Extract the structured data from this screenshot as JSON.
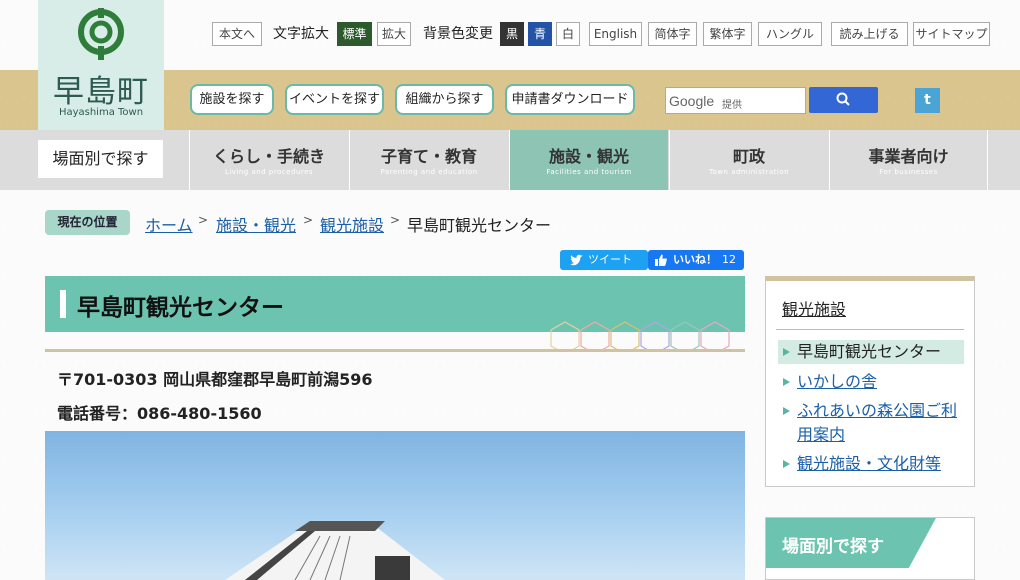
{
  "logo": {
    "name": "早島町",
    "sub": "Hayashima Town"
  },
  "toolbar": {
    "honbun": "本文へ",
    "moji_label": "文字拡大",
    "hyojun": "標準",
    "kakudai": "拡大",
    "bg_label": "背景色変更",
    "kuro": "黒",
    "ao": "青",
    "shiro": "白",
    "english": "English",
    "kantai": "简体字",
    "hantai": "繁体字",
    "hangul": "ハングル",
    "yomiage": "読み上げる",
    "sitemap": "サイトマップ"
  },
  "quick": [
    "施設を探す",
    "イベントを探す",
    "組織から探す",
    "申請書ダウンロード"
  ],
  "search": {
    "brand": "Google",
    "provided": "提供"
  },
  "tumblr": "t",
  "nav": {
    "scene": "場面別で探す",
    "items": [
      {
        "jp": "くらし・手続き",
        "en": "Living and procedures"
      },
      {
        "jp": "子育て・教育",
        "en": "Parenting and education"
      },
      {
        "jp": "施設・観光",
        "en": "Facilities and tourism"
      },
      {
        "jp": "町政",
        "en": "Town administration"
      },
      {
        "jp": "事業者向け",
        "en": "For businesses"
      }
    ]
  },
  "breadcrumb": {
    "badge": "現在の位置",
    "items": [
      "ホーム",
      "施設・観光",
      "観光施設"
    ],
    "current": "早島町観光センター"
  },
  "social": {
    "tweet": "ツイート",
    "like": "いいね！",
    "like_count": "12"
  },
  "page": {
    "title": "早島町観光センター",
    "address": "〒701-0303 岡山県都窪郡早島町前潟596",
    "tel": "電話番号：086-480-1560"
  },
  "side": {
    "heading": "観光施設",
    "items": [
      "早島町観光センター",
      "いかしの舎",
      "ふれあいの森公園ご利用案内",
      "観光施設・文化財等"
    ]
  },
  "scene_box": {
    "label": "場面別で探す"
  },
  "colors": {
    "teal": "#6cc4b0",
    "tan": "#d9c58d",
    "link": "#1a5fa8"
  }
}
